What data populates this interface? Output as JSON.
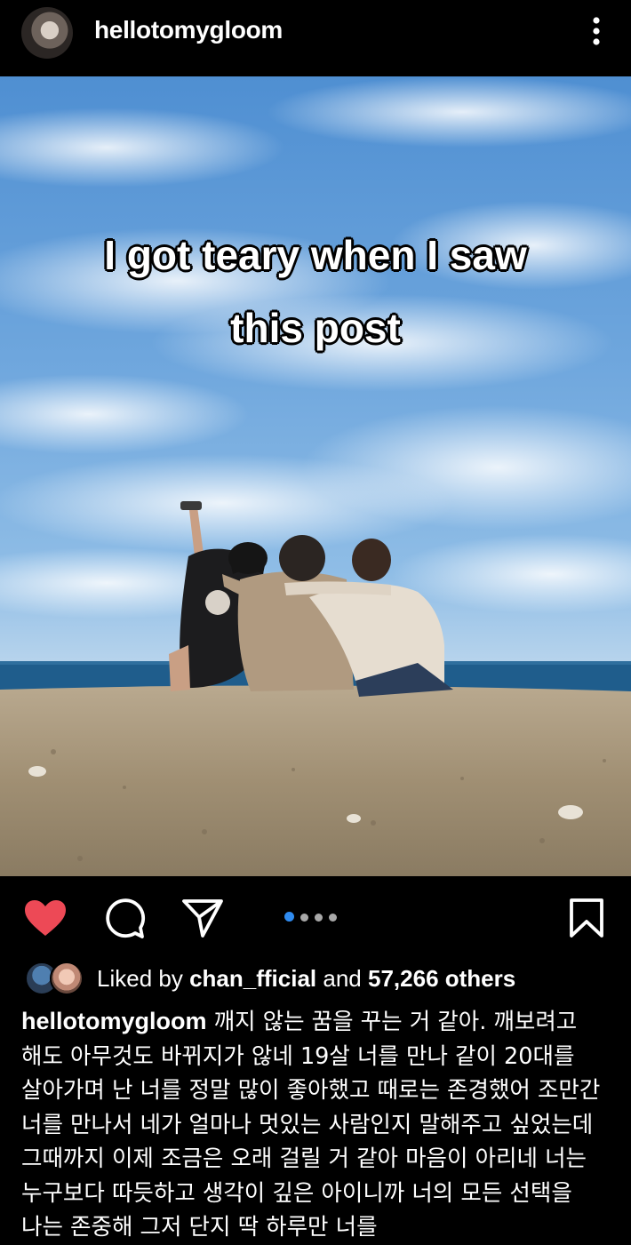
{
  "header": {
    "username": "hellotomygloom",
    "avatar": "user-avatar",
    "menu_icon": "more-vertical-icon"
  },
  "post": {
    "overlay_text_line1": "I got teary when I saw",
    "overlay_text_line2": "this post",
    "carousel": {
      "count": 4,
      "active_index": 0
    }
  },
  "actions": {
    "like_icon": "heart-filled-icon",
    "comment_icon": "comment-icon",
    "share_icon": "send-icon",
    "save_icon": "bookmark-icon",
    "like_color": "#ed4956",
    "carousel_active_color": "#2f8bf0"
  },
  "likes": {
    "prefix": "Liked by",
    "user": "chan_fficial",
    "middle": "and",
    "count_text": "57,266 others"
  },
  "caption": {
    "username": "hellotomygloom",
    "text": " 깨지 않는 꿈을 꾸는 거 같아. 깨보려고 해도 아무것도 바뀌지가 않네 19살 너를 만나 같이 20대를 살아가며 난 너를 정말 많이 좋아했고 때로는 존경했어 조만간 너를 만나서 네가 얼마나 멋있는 사람인지 말해주고 싶었는데 그때까지 이제 조금은 오래 걸릴 거 같아 마음이 아리네 너는 누구보다 따듯하고 생각이 깊은 아이니까 너의 모든 선택을 나는 존중해 그저 단지 딱 하루만 너를"
  }
}
